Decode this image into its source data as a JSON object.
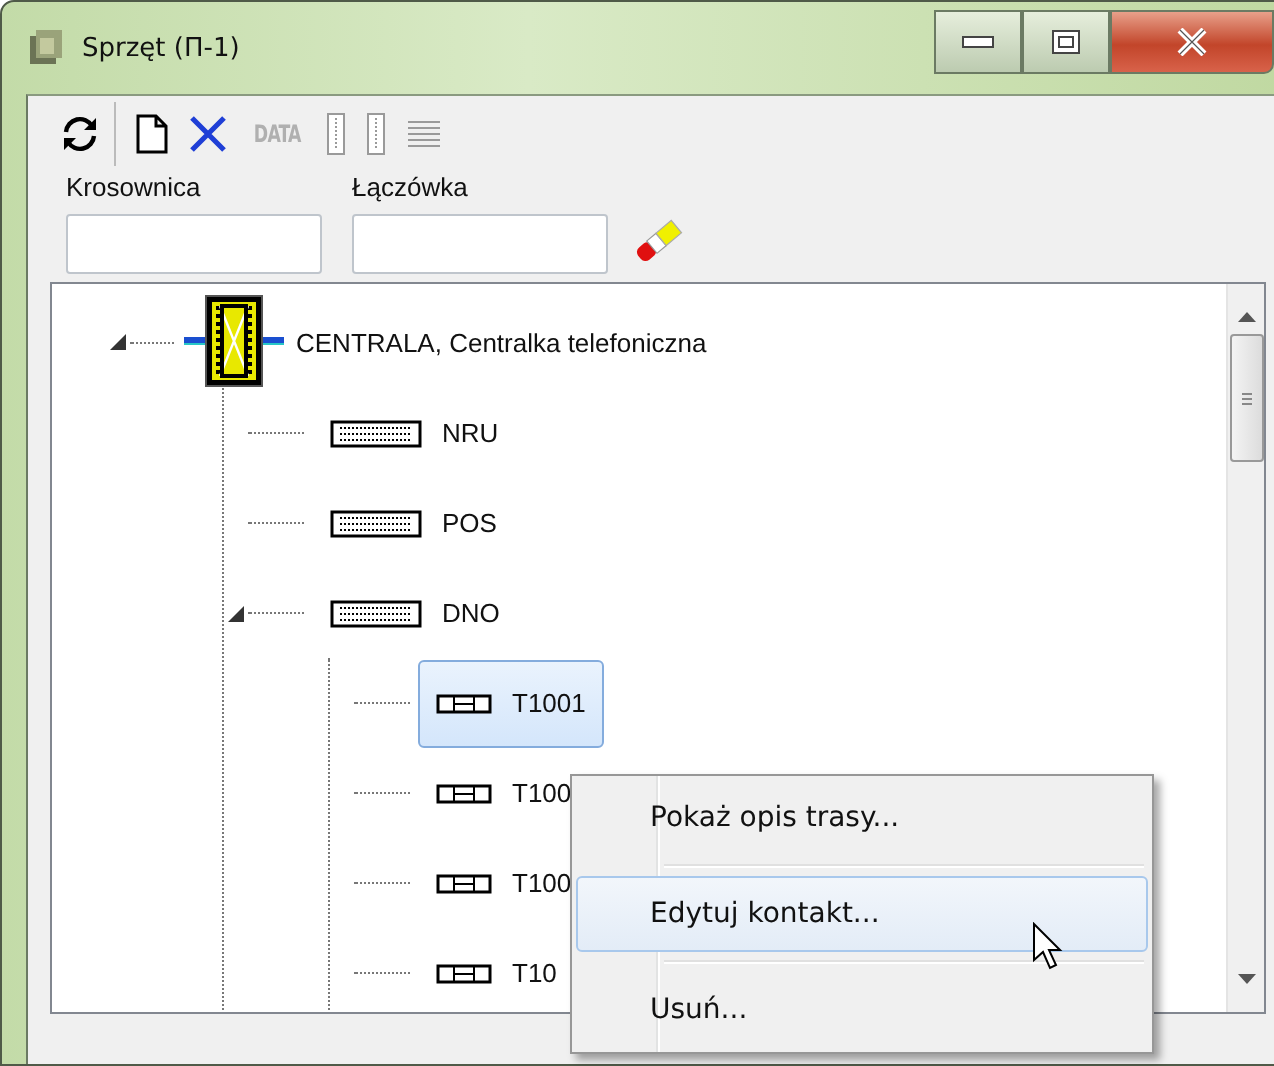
{
  "window": {
    "title": "Sprzęt (П-1)"
  },
  "toolbar": [
    {
      "kind": "refresh",
      "disabled": false
    },
    {
      "kind": "new",
      "disabled": false
    },
    {
      "kind": "delete",
      "disabled": false
    },
    {
      "kind": "text",
      "label": "DATA",
      "disabled": true
    },
    {
      "kind": "block",
      "disabled": true
    },
    {
      "kind": "block",
      "disabled": true
    },
    {
      "kind": "lines",
      "disabled": true
    }
  ],
  "fields": [
    {
      "label": "Krosownica"
    },
    {
      "label": "Łączówka"
    }
  ],
  "tree": [
    {
      "label": "CENTRALA, Centralka telefoniczna",
      "kind": "exchange",
      "expanded": true,
      "selected": false,
      "children": [
        {
          "label": "NRU",
          "kind": "block",
          "selected": false
        },
        {
          "label": "POS",
          "kind": "block",
          "selected": false
        },
        {
          "label": "DNO",
          "kind": "block",
          "expanded": true,
          "selected": false,
          "children": [
            {
              "label": "T1001",
              "kind": "terminal",
              "selected": true
            },
            {
              "label": "T100",
              "kind": "terminal",
              "selected": false
            },
            {
              "label": "T100",
              "kind": "terminal",
              "selected": false
            },
            {
              "label": "T10",
              "kind": "terminal",
              "selected": false
            }
          ]
        }
      ]
    }
  ],
  "context_menu": [
    {
      "label": "Pokaż opis trasy...",
      "selected": false
    },
    {
      "label": "Edytuj kontakt...",
      "selected": true
    },
    {
      "label": "Usuń...",
      "selected": false
    }
  ]
}
